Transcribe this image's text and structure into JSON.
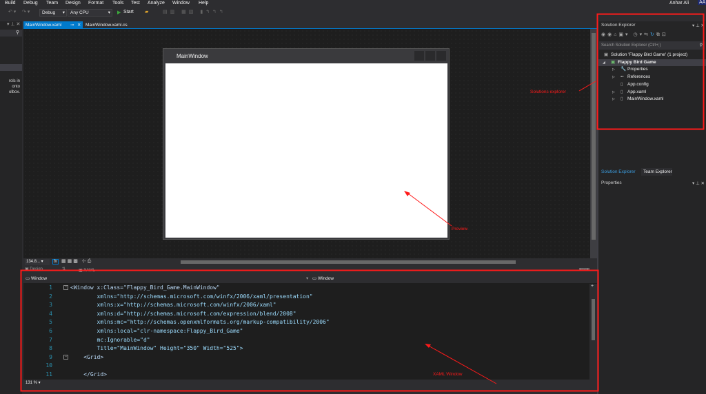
{
  "menu": [
    "Build",
    "Debug",
    "Team",
    "Design",
    "Format",
    "Tools",
    "Test",
    "Analyze",
    "Window",
    "Help"
  ],
  "user": {
    "name": "Anhar Ali",
    "initials": "AA"
  },
  "toolbar": {
    "config": "Debug",
    "platform": "Any CPU",
    "start": "Start"
  },
  "toolbox": {
    "hint": [
      "rols in",
      " onto",
      "olbox."
    ]
  },
  "tabs": [
    {
      "label": "MainWindow.xaml",
      "active": true
    },
    {
      "label": "MainWindow.xaml.cs",
      "active": false
    }
  ],
  "preview": {
    "title": "MainWindow"
  },
  "zoom_bar": {
    "zoom": "134.8...",
    "fx": "fx"
  },
  "view_tabs": {
    "design": "Design",
    "xaml": "XAML"
  },
  "editor": {
    "left_scope": "Window",
    "right_scope": "Window",
    "zoom": "131 %",
    "lines": [
      {
        "n": "1",
        "text": "<Window x:Class=\"Flappy_Bird_Game.MainWindow\""
      },
      {
        "n": "2",
        "text": "        xmlns=\"http://schemas.microsoft.com/winfx/2006/xaml/presentation\""
      },
      {
        "n": "3",
        "text": "        xmlns:x=\"http://schemas.microsoft.com/winfx/2006/xaml\""
      },
      {
        "n": "4",
        "text": "        xmlns:d=\"http://schemas.microsoft.com/expression/blend/2008\""
      },
      {
        "n": "5",
        "text": "        xmlns:mc=\"http://schemas.openxmlformats.org/markup-compatibility/2006\""
      },
      {
        "n": "6",
        "text": "        xmlns:local=\"clr-namespace:Flappy_Bird_Game\""
      },
      {
        "n": "7",
        "text": "        mc:Ignorable=\"d\""
      },
      {
        "n": "8",
        "text": "        Title=\"MainWindow\" Height=\"350\" Width=\"525\">"
      },
      {
        "n": "9",
        "text": "    <Grid>"
      },
      {
        "n": "10",
        "text": ""
      },
      {
        "n": "11",
        "text": "    </Grid>"
      }
    ]
  },
  "solution_explorer": {
    "title": "Solution Explorer",
    "search_placeholder": "Search Solution Explorer (Ctrl+;)",
    "items": [
      {
        "label": "Solution 'Flappy Bird Game' (1 project)",
        "level": 0
      },
      {
        "label": "Flappy Bird Game",
        "level": 1,
        "bold": true
      },
      {
        "label": "Properties",
        "level": 2
      },
      {
        "label": "References",
        "level": 2
      },
      {
        "label": "App.config",
        "level": 2
      },
      {
        "label": "App.xaml",
        "level": 2
      },
      {
        "label": "MainWindow.xaml",
        "level": 2
      }
    ]
  },
  "right_tabs": [
    "Solution Explorer",
    "Team Explorer"
  ],
  "properties": {
    "title": "Properties"
  },
  "annotations": {
    "solutions": "Solutions explorer",
    "preview": "Preview",
    "xaml": "XAML Window",
    "color": "#ff1a1a"
  }
}
